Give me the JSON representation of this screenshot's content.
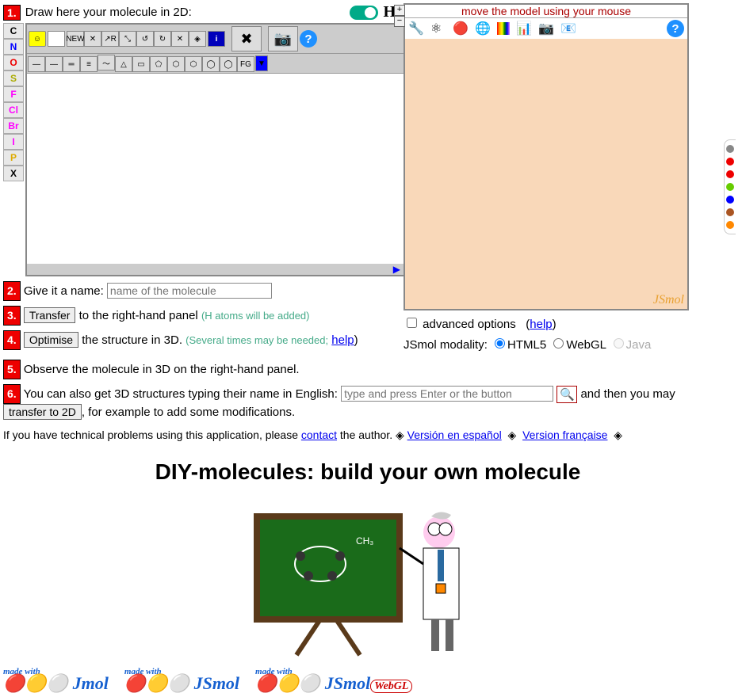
{
  "step1": {
    "num": "1.",
    "text": "Draw here your molecule in 2D:"
  },
  "h_label": "H",
  "elements": [
    {
      "sym": "C",
      "color": "#000"
    },
    {
      "sym": "N",
      "color": "#00f"
    },
    {
      "sym": "O",
      "color": "#e00"
    },
    {
      "sym": "S",
      "color": "#aa0"
    },
    {
      "sym": "F",
      "color": "#f0f"
    },
    {
      "sym": "Cl",
      "color": "#f0f"
    },
    {
      "sym": "Br",
      "color": "#f0f"
    },
    {
      "sym": "I",
      "color": "#f0f"
    },
    {
      "sym": "P",
      "color": "#da0"
    },
    {
      "sym": "X",
      "color": "#000"
    }
  ],
  "toolbar1": [
    "NEW",
    "✕",
    "↗R",
    "⤡",
    "↺",
    "↻",
    "✕",
    "◈",
    "i"
  ],
  "toolbar2": [
    "—",
    "—",
    "═",
    "≡",
    "〜",
    "△",
    "▭",
    "⬠",
    "⬡",
    "⬡",
    "◯",
    "◯",
    "FG"
  ],
  "step2": {
    "num": "2.",
    "text": "Give it a name:",
    "placeholder": "name of the molecule"
  },
  "step3": {
    "num": "3.",
    "btn": "Transfer",
    "text": "to the right-hand panel",
    "hint": "(H atoms will be added)"
  },
  "step4": {
    "num": "4.",
    "btn": "Optimise",
    "text": "the structure in 3D.",
    "hint": "(Several times may be needed;",
    "help": "help",
    "paren": ")"
  },
  "step5": {
    "num": "5.",
    "text": "Observe the molecule in 3D on the right-hand panel."
  },
  "step6": {
    "num": "6.",
    "text1": "You can also get 3D structures typing their name in English:",
    "placeholder": "type and press Enter or the button",
    "text2": "and then you may",
    "btn": "transfer to 2D",
    "text3": ", for example to add some modifications."
  },
  "footer": {
    "text1": "If you have technical problems using this application, please",
    "contact": "contact",
    "text2": "the author.  ◈",
    "es": "Versión en español",
    "sep": "◈",
    "fr": "Version française",
    "end": "◈"
  },
  "jsmol": {
    "title": "move the model using your mouse",
    "brand": "JSmol"
  },
  "adv": {
    "label": "advanced options",
    "help": "help"
  },
  "modality": {
    "label": "JSmol modality:",
    "opts": [
      "HTML5",
      "WebGL",
      "Java"
    ]
  },
  "title": "DIY-molecules: build your own molecule",
  "logos": [
    {
      "made": "made with",
      "name": "Jmol"
    },
    {
      "made": "made with",
      "name": "JSmol"
    },
    {
      "made": "made with",
      "name": "JSmol",
      "tag": "WebGL"
    }
  ],
  "strip_colors": [
    "#888",
    "#e00",
    "#e00",
    "#6c0",
    "#00f",
    "#a52",
    "#f80"
  ]
}
